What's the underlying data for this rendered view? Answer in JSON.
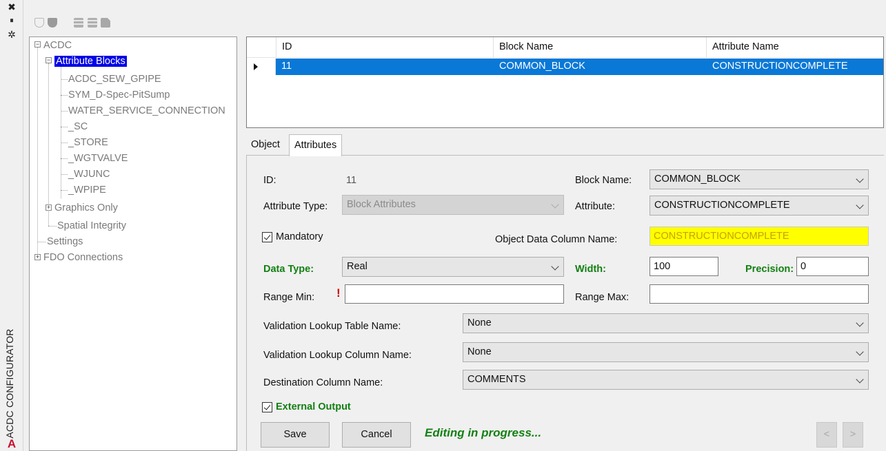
{
  "window": {
    "vertical_title": "ACDC CONFIGURATOR"
  },
  "strip": {
    "close_glyph": "✖",
    "pin_glyph": "⏸",
    "settings_glyph": "✲",
    "logo": "A"
  },
  "toolbar": {
    "icons": [
      "shield-outline-icon",
      "shield-dark-icon",
      "grid-table-icon-1",
      "grid-table-icon-2",
      "export-icon"
    ]
  },
  "tree": {
    "root": "ACDC",
    "attribute_blocks": "Attribute Blocks",
    "children": [
      "ACDC_SEW_GPIPE",
      "SYM_D-Spec-PitSump",
      "WATER_SERVICE_CONNECTION",
      "_SC",
      "_STORE",
      "_WGTVALVE",
      "_WJUNC",
      "_WPIPE"
    ],
    "graphics_only": "Graphics Only",
    "spatial_integrity": "Spatial Integrity",
    "settings": "Settings",
    "fdo_connections": "FDO Connections"
  },
  "grid": {
    "columns": [
      "ID",
      "Block Name",
      "Attribute Name"
    ],
    "rows": [
      {
        "id": "11",
        "block_name": "COMMON_BLOCK",
        "attribute_name": "CONSTRUCTIONCOMPLETE"
      }
    ]
  },
  "tabs": [
    "Object",
    "Attributes"
  ],
  "form": {
    "id_label": "ID:",
    "id_value": "11",
    "block_name_label": "Block Name:",
    "block_name_value": "COMMON_BLOCK",
    "attribute_type_label": "Attribute Type:",
    "attribute_type_value": "Block Attributes",
    "attribute_label": "Attribute:",
    "attribute_value": "CONSTRUCTIONCOMPLETE",
    "mandatory_label": "Mandatory",
    "object_data_column_label": "Object Data Column Name:",
    "object_data_column_value": "CONSTRUCTIONCOMPLETE",
    "data_type_label": "Data Type:",
    "data_type_value": "Real",
    "width_label": "Width:",
    "width_value": "100",
    "precision_label": "Precision:",
    "precision_value": "0",
    "range_min_label": "Range Min:",
    "range_min_value": "",
    "required_mark": "!",
    "range_max_label": "Range Max:",
    "range_max_value": "",
    "validation_table_label": "Validation Lookup Table Name:",
    "validation_table_value": "None",
    "validation_column_label": "Validation Lookup Column Name:",
    "validation_column_value": "None",
    "destination_column_label": "Destination Column Name:",
    "destination_column_value": "COMMENTS",
    "external_output_label": "External Output",
    "save_label": "Save",
    "cancel_label": "Cancel",
    "status": "Editing in progress...",
    "prev_glyph": "<",
    "next_glyph": ">"
  },
  "colors": {
    "selection_blue": "#0a78d7",
    "tree_selection": "#0000e6",
    "green_label": "#138013",
    "highlight_yellow": "#ffff00"
  }
}
